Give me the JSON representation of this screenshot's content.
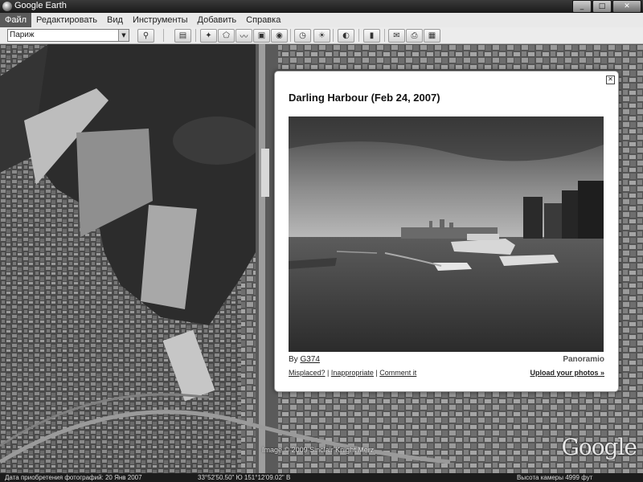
{
  "window": {
    "title": "Google Earth",
    "minimize": "_",
    "maximize": "□",
    "close": "✕"
  },
  "menu": {
    "items": [
      "Файл",
      "Редактировать",
      "Вид",
      "Инструменты",
      "Добавить",
      "Справка"
    ]
  },
  "search": {
    "value": "Париж"
  },
  "toolbar": {
    "icons": [
      "search-icon",
      "sidebar-icon",
      "placemark-icon",
      "polygon-icon",
      "path-icon",
      "image-overlay-icon",
      "tour-icon",
      "history-icon",
      "sun-icon",
      "planet-icon",
      "ruler-icon",
      "email-icon",
      "print-icon",
      "maps-icon"
    ]
  },
  "popup": {
    "title": "Darling Harbour (Feb 24, 2007)",
    "by_label": "By",
    "author": "G374",
    "brand": "Panoramio",
    "link_misplaced": "Misplaced?",
    "link_inappropriate": "Inappropriate",
    "link_comment": "Comment it",
    "upload": "Upload your photos »",
    "close": "✕"
  },
  "map": {
    "credit": "Image © 2009 Sinclair Knight Merz",
    "logo": "Google"
  },
  "status": {
    "date": "Дата приобретения фотографий: 20 Янв 2007",
    "coords": "33°52'50.50\" Ю    151°12'09.02\" В",
    "altitude": "Высота камеры    4999 фут"
  }
}
